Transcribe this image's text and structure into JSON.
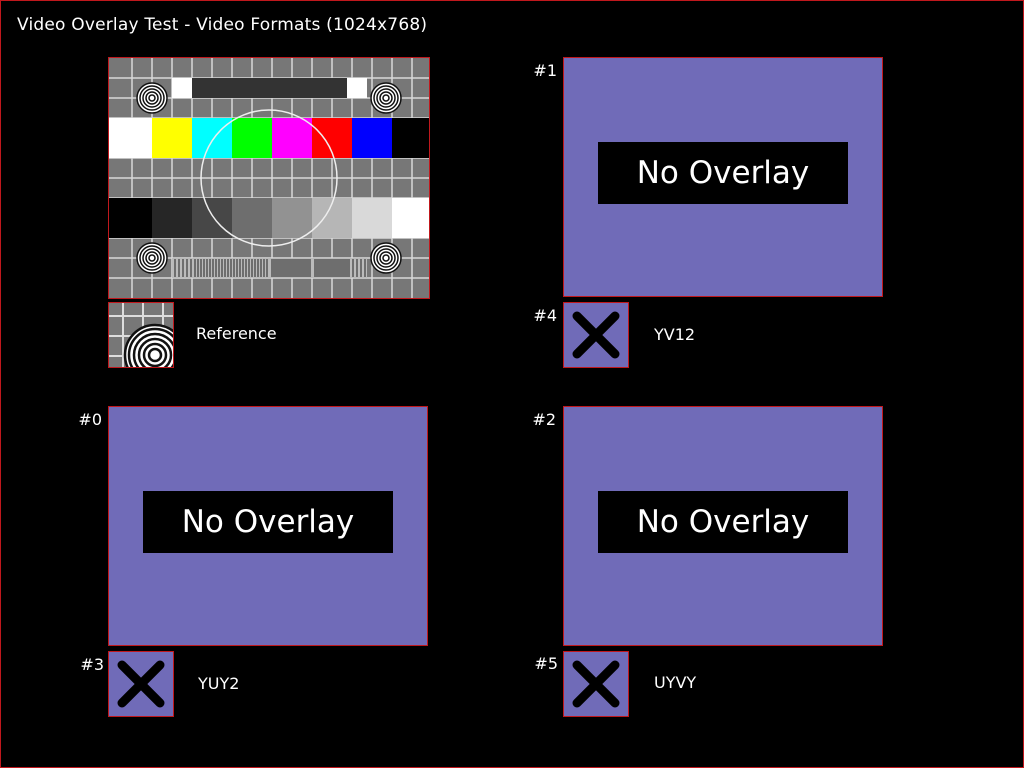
{
  "window": {
    "title": "Video Overlay Test - Video Formats (1024x768)"
  },
  "reference": {
    "label": "Reference"
  },
  "panels": {
    "p1": {
      "number": "#1",
      "text": "No Overlay"
    },
    "p0": {
      "number": "#0",
      "text": "No Overlay"
    },
    "p2": {
      "number": "#2",
      "text": "No Overlay"
    }
  },
  "formats": {
    "f4": {
      "number": "#4",
      "label": "YV12"
    },
    "f3": {
      "number": "#3",
      "label": "YUY2"
    },
    "f5": {
      "number": "#5",
      "label": "UYVY"
    }
  },
  "colors": {
    "panel": "#706bb8",
    "border": "#c0181d",
    "background": "#000000"
  },
  "icons": {
    "thumb": "x-mark-icon",
    "reference": "test-card-icon"
  }
}
